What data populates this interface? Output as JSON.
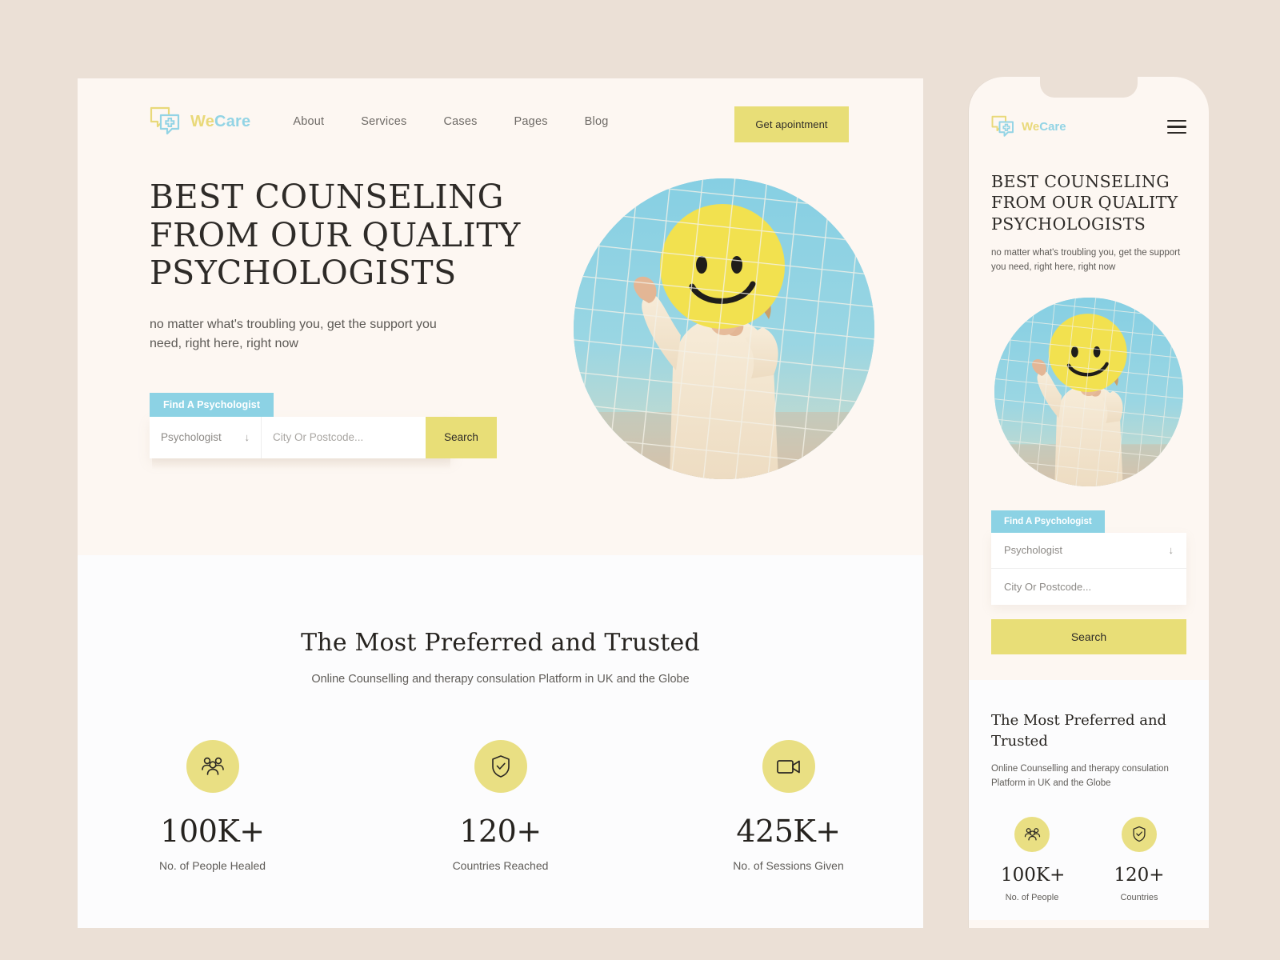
{
  "theme": {
    "page_bg": "#ebe0d6",
    "card_bg": "#fdf7f2",
    "stats_bg": "#fcfcfd",
    "accent_yellow": "#e8de77",
    "accent_blue": "#8cd2e4",
    "text_dark": "#2e2b28",
    "text_muted": "#5c5955"
  },
  "desktop": {
    "brand": {
      "part1": "We",
      "part2": "Care",
      "logo_icon": "chat-bubbles-plus-icon"
    },
    "nav": {
      "links": [
        {
          "label": "About"
        },
        {
          "label": "Services"
        },
        {
          "label": "Cases"
        },
        {
          "label": "Pages"
        },
        {
          "label": "Blog"
        }
      ],
      "cta_label": "Get apointment"
    },
    "hero": {
      "title": "BEST COUNSELING FROM OUR QUALITY PSYCHOLOGISTS",
      "subtitle": "no matter what's troubling you, get the support you need, right here, right now",
      "image_alt": "person-with-smiley-balloon-behind-net"
    },
    "search": {
      "tab_label": "Find A Psychologist",
      "select_value": "Psychologist",
      "select_icon": "arrow-down-icon",
      "city_placeholder": "City Or Postcode...",
      "city_value": "",
      "button_label": "Search"
    },
    "stats": {
      "title": "The Most Preferred and Trusted",
      "subtitle": "Online Counselling and therapy consulation Platform in UK and the Globe",
      "items": [
        {
          "icon": "people-group-icon",
          "value": "100K+",
          "label": "No. of People Healed"
        },
        {
          "icon": "shield-check-icon",
          "value": "120+",
          "label": "Countries Reached"
        },
        {
          "icon": "video-camera-icon",
          "value": "425K+",
          "label": "No. of Sessions Given"
        }
      ]
    }
  },
  "mobile": {
    "brand": {
      "part1": "We",
      "part2": "Care",
      "logo_icon": "chat-bubbles-plus-icon"
    },
    "menu_icon": "hamburger-menu-icon",
    "hero": {
      "title": "BEST COUNSELING FROM OUR QUALITY PSYCHOLOGISTS",
      "subtitle": "no matter what's troubling you, get the support  you need, right here, right now",
      "image_alt": "person-with-smiley-balloon-behind-net"
    },
    "search": {
      "tab_label": "Find A Psychologist",
      "select_value": "Psychologist",
      "select_icon": "arrow-down-icon",
      "city_placeholder": "City Or Postcode...",
      "button_label": "Search"
    },
    "stats": {
      "title": "The Most Preferred and Trusted",
      "subtitle": "Online Counselling and therapy consulation Platform in UK and the Globe",
      "items": [
        {
          "icon": "people-group-icon",
          "value": "100K+",
          "label": "No. of People"
        },
        {
          "icon": "shield-check-icon",
          "value": "120+",
          "label": "Countries"
        }
      ]
    }
  }
}
